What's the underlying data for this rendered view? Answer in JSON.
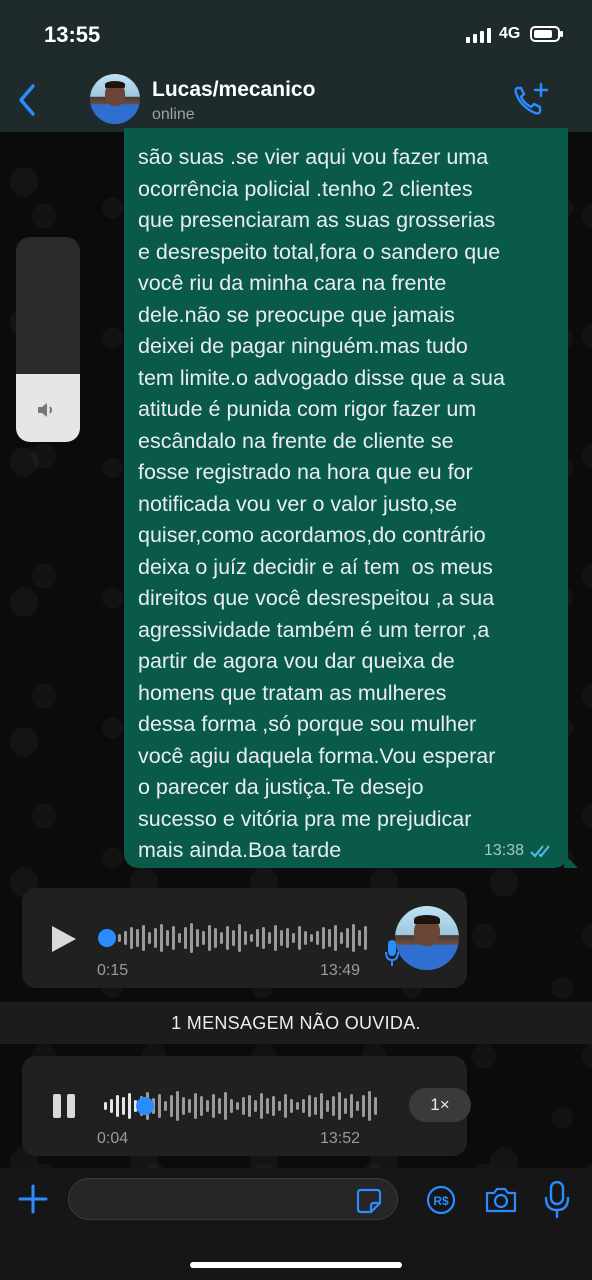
{
  "status_bar": {
    "time": "13:55",
    "network": "4G"
  },
  "header": {
    "contact_name": "Lucas/mecanico",
    "presence": "online"
  },
  "message": {
    "text": "são suas .se vier aqui vou fazer uma\nocorrência policial .tenho 2 clientes\nque presenciaram as suas grosserias\ne desrespeito total,fora o sandero que\nvocê riu da minha cara na frente\ndele.não se preocupe que jamais\ndeixei de pagar ninguém.mas tudo\ntem limite.o advogado disse que a sua\natitude é punida com rigor fazer um\nescândalo na frente de cliente se\nfosse registrado na hora que eu for\nnotificada vou ver o valor justo,se\nquiser,como acordamos,do contrário\ndeixa o juíz decidir e aí tem  os meus\ndireitos que você desrespeitou ,a sua\nagressividade também é um terror ,a\npartir de agora vou dar queixa de\nhomens que tratam as mulheres\ndessa forma ,só porque sou mulher\nvocê agiu daquela forma.Vou esperar\no parecer da justiça.Te desejo\nsucesso e vitória pra me prejudicar\nmais ainda.Boa tarde",
    "time": "13:38",
    "status": "read"
  },
  "volume_overlay": {
    "level": 0.33
  },
  "voice_messages": [
    {
      "duration": "0:15",
      "time": "13:49",
      "state": "paused",
      "progress": 0.0
    },
    {
      "duration": "0:04",
      "time": "13:52",
      "state": "playing",
      "progress": 0.14,
      "speed": "1×"
    }
  ],
  "unread_banner": "1 MENSAGEM NÃO OUVIDA.",
  "composer": {
    "placeholder": ""
  },
  "colors": {
    "accent": "#2a8cff",
    "bubble": "#0a5a49",
    "header": "#1e2a2b"
  },
  "icons": [
    "back-icon",
    "add-call-icon",
    "speaker-icon",
    "play-icon",
    "pause-icon",
    "mic-icon",
    "plus-icon",
    "sticker-icon",
    "payment-icon",
    "camera-icon",
    "read-receipt-icon"
  ]
}
